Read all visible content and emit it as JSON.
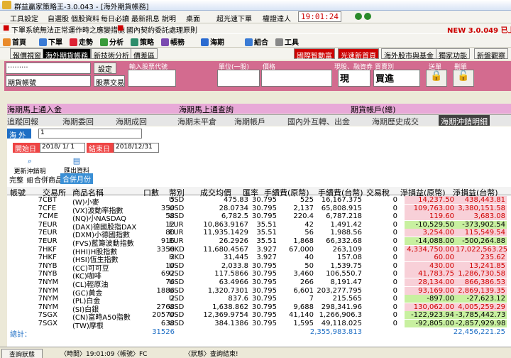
{
  "window": {
    "title": "群益贏家策略王-3.0.043 - [海外期貨帳務]"
  },
  "menu": [
    "工具設定",
    "自選股",
    "個股資料",
    "每日必讀",
    "最新訊息",
    "說明",
    "桌面",
    "超光速下單",
    "權證達人"
  ],
  "clock": "19:01:24",
  "banner": {
    "version_notice": "NEW 3.0.049 已上線",
    "warning": "下單系統無法正常運作時之應變措施",
    "hint": "國內契約委託處理原則"
  },
  "toolbar": [
    "首頁",
    "下單",
    "走勢",
    "分析",
    "策略",
    "帳務",
    "海期",
    "組合",
    "工具"
  ],
  "toolbar_right": [
    "國際智動富",
    "光速新首頁",
    "海外股市與基金",
    "獨家功能",
    "新盤觀察"
  ],
  "subtabs": [
    "報價視窗",
    "海外期貨帳務",
    "新技術分析",
    "價差區"
  ],
  "order_panel": {
    "labels": {
      "symbol": "輸入股票代號",
      "lots": "單位(一股)",
      "price": "價格",
      "cash_margin": "現股、融資券",
      "buy_sell": "買賣別",
      "send": "送單",
      "delete": "刪單"
    },
    "account_masked": "·········",
    "account_type": "期貨帳號",
    "confirm": "設定",
    "stock_trade": "股票交易",
    "cash_value": "現",
    "buy_value": "買進"
  },
  "nav1": [
    "海期馬上通入金",
    "海期馬上通查詢",
    "期貨帳戶(總)"
  ],
  "nav2": [
    "追蹤回報",
    "海期委回",
    "海期成回",
    "海期未平倉",
    "海期帳戶",
    "國內外互轉、出金",
    "海期歷史成交",
    "海期沖銷明細"
  ],
  "filter": {
    "overseas_label": "海 外",
    "account_value": "1",
    "start_label": "開始日",
    "start_date": "2018/ 1/ 1",
    "end_label": "結束日",
    "end_date": "2018/12/31",
    "refresh": "更新沖銷明細",
    "export": "匯出資料"
  },
  "views": [
    "完整",
    "合併商品",
    "合併月份"
  ],
  "columns": [
    "帳號",
    "交易所",
    "商品名稱",
    "口數",
    "幣別",
    "成交均價",
    "匯率",
    "手續費(原幣)",
    "手續費(台幣)",
    "交易稅",
    "淨損益(原幣)",
    "淨損益(台幣)"
  ],
  "rows": [
    [
      "7",
      "CBT",
      "(W)小麥",
      "5",
      "USD",
      "475.83",
      "30.795",
      "525",
      "16,167.375",
      "0",
      "14,237.50",
      "438,443.81"
    ],
    [
      "7",
      "CFE",
      "(VX)波動率指數",
      "350",
      "USD",
      "28.0734",
      "30.795",
      "2,137",
      "65,808.915",
      "0",
      "109,763.00",
      "3,380,151.58"
    ],
    [
      "7",
      "CME",
      "(NQ)小NASDAQ",
      "58",
      "USD",
      "6,782.5",
      "30.795",
      "220.4",
      "6,787.218",
      "0",
      "119.60",
      "3,683.08"
    ],
    [
      "7",
      "EUR",
      "(DAX)德國股指DAX",
      "12",
      "EUR",
      "10,863.9167",
      "35.51",
      "42",
      "1,491.42",
      "0",
      "-10,529.50",
      "-373,902.54"
    ],
    [
      "7",
      "EUR",
      "(DXM)小德國指數",
      "80",
      "EUR",
      "11,935.1429",
      "35.51",
      "56",
      "1,988.56",
      "0",
      "3,254.00",
      "115,549.54"
    ],
    [
      "7",
      "EUR",
      "(FVS)藍籌波動指數",
      "916",
      "EUR",
      "26.2926",
      "35.51",
      "1,868",
      "66,332.68",
      "0",
      "-14,088.00",
      "-500,264.88"
    ],
    [
      "7",
      "HKF",
      "(HHI)H股指數",
      "3350",
      "HKD",
      "11,680.4567",
      "3.927",
      "67,000",
      "263,109",
      "0",
      "4,334,750.00",
      "17,022,563.25"
    ],
    [
      "7",
      "HKF",
      "(HSI)恆生指數",
      "2",
      "HKD",
      "31,445",
      "3.927",
      "40",
      "157.08",
      "0",
      "60.00",
      "235.62"
    ],
    [
      "7",
      "NYB",
      "(CC)可可豆",
      "10",
      "USD",
      "2,033.8",
      "30.795",
      "50",
      "1,539.75",
      "0",
      "430.00",
      "13,241.85"
    ],
    [
      "7",
      "NYB",
      "(KC)咖啡",
      "692",
      "USD",
      "117.5866",
      "30.795",
      "3,460",
      "106,550.7",
      "0",
      "41,783.75",
      "1,286,730.58"
    ],
    [
      "7",
      "NYM",
      "(CL)輕原油",
      "76",
      "USD",
      "63.4966",
      "30.795",
      "266",
      "8,191.47",
      "0",
      "28,134.00",
      "866,386.53"
    ],
    [
      "7",
      "NYM",
      "(GC)黃金",
      "1886",
      "USD",
      "1,320.7301",
      "30.795",
      "6,601",
      "203,277.795",
      "0",
      "93,169.00",
      "2,869,139.35"
    ],
    [
      "7",
      "NYM",
      "(PL)白金",
      "2",
      "USD",
      "837.6",
      "30.795",
      "7",
      "215.565",
      "0",
      "-897.00",
      "-27,623.12"
    ],
    [
      "7",
      "NYM",
      "(SI)白銀",
      "2768",
      "USD",
      "1,638.862",
      "30.795",
      "9,688",
      "298,341.96",
      "0",
      "130,062.00",
      "4,005,259.29"
    ],
    [
      "7",
      "SGX",
      "(CN)富時A50指數",
      "20570",
      "USD",
      "12,369.9754",
      "30.795",
      "41,140",
      "1,266,906.3",
      "0",
      "-122,923.94",
      "-3,785,442.73"
    ],
    [
      "7",
      "SGX",
      "(TW)摩根",
      "638",
      "USD",
      "384.1386",
      "30.795",
      "1,595",
      "49,118.025",
      "0",
      "-92,805.00",
      "-2,857,929.98"
    ]
  ],
  "total": {
    "label": "總計：",
    "lots": "31526",
    "fee_twd": "2,355,983.813",
    "pnl_twd": "22,456,221.25"
  },
  "status": {
    "state": "查詢狀態",
    "time_label": "〈時間〉19:01:09",
    "account_label": "〈帳號〉FC",
    "status_label": "〈狀態〉查詢結束!"
  }
}
